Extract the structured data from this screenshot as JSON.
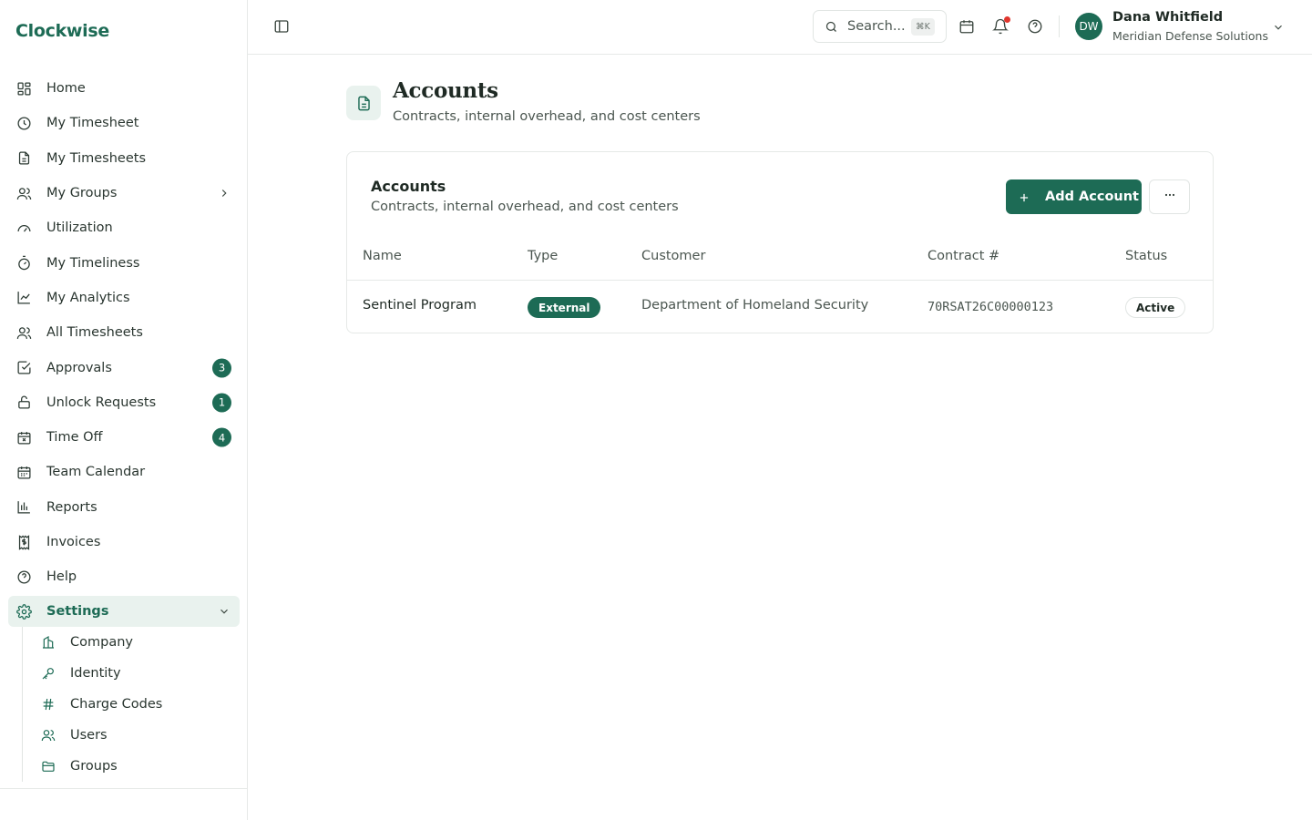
{
  "app": {
    "brand": "Clockwise"
  },
  "sidebar": {
    "items": [
      {
        "label": "Home",
        "icon": "home-grid-icon"
      },
      {
        "label": "My Timesheet",
        "icon": "clock-icon"
      },
      {
        "label": "My Timesheets",
        "icon": "document-icon"
      },
      {
        "label": "My Groups",
        "icon": "users-icon"
      },
      {
        "label": "Utilization",
        "icon": "gauge-icon"
      },
      {
        "label": "My Timeliness",
        "icon": "stopwatch-icon"
      },
      {
        "label": "My Analytics",
        "icon": "line-chart-icon"
      },
      {
        "label": "All Timesheets",
        "icon": "users-icon"
      },
      {
        "label": "Approvals",
        "icon": "check-square-icon",
        "badge": "3"
      },
      {
        "label": "Unlock Requests",
        "icon": "lock-open-icon",
        "badge": "1"
      },
      {
        "label": "Time Off",
        "icon": "calendar-x-icon",
        "badge": "4"
      },
      {
        "label": "Team Calendar",
        "icon": "calendar-icon"
      },
      {
        "label": "Reports",
        "icon": "bar-chart-icon"
      },
      {
        "label": "Invoices",
        "icon": "receipt-icon"
      },
      {
        "label": "Help",
        "icon": "help-circle-icon"
      },
      {
        "label": "Settings",
        "icon": "gear-icon"
      }
    ],
    "settings_sub": [
      {
        "label": "Company",
        "icon": "building-icon"
      },
      {
        "label": "Identity",
        "icon": "key-icon"
      },
      {
        "label": "Charge Codes",
        "icon": "hash-icon"
      },
      {
        "label": "Users",
        "icon": "users-icon"
      },
      {
        "label": "Groups",
        "icon": "folder-icon"
      }
    ]
  },
  "topbar": {
    "search_placeholder": "Search...",
    "search_shortcut": "⌘K",
    "user_initials": "DW",
    "user_name": "Dana Whitfield",
    "user_org": "Meridian Defense Solutions"
  },
  "page": {
    "title": "Accounts",
    "subtitle": "Contracts, internal overhead, and cost centers"
  },
  "card": {
    "title": "Accounts",
    "subtitle": "Contracts, internal overhead, and cost centers",
    "add_button": "Add Account",
    "columns": [
      "Name",
      "Type",
      "Customer",
      "Contract #",
      "Status"
    ],
    "rows": [
      {
        "name": "Sentinel Program",
        "type": "External",
        "customer": "Department of Homeland Security",
        "contract": "70RSAT26C00000123",
        "status": "Active"
      }
    ]
  },
  "colors": {
    "accent": "#1d6b55",
    "accent_soft": "#e9f2ee",
    "notification": "#e0362d"
  }
}
